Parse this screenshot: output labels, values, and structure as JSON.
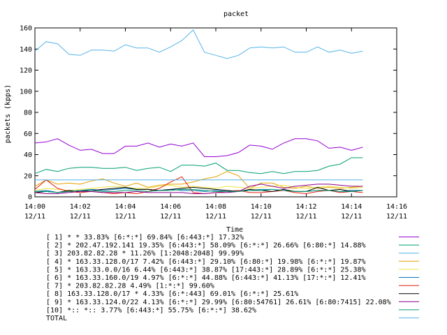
{
  "chart_data": {
    "type": "line",
    "title": "packet",
    "xlabel": "Time",
    "ylabel": "packets (kpps)",
    "ylim": [
      0,
      160
    ],
    "y_ticks": [
      "0",
      "20",
      "40",
      "60",
      "80",
      "100",
      "120",
      "140",
      "160"
    ],
    "x_ticks": [
      {
        "time": "14:00",
        "date": "12/11"
      },
      {
        "time": "14:02",
        "date": "12/11"
      },
      {
        "time": "14:04",
        "date": "12/11"
      },
      {
        "time": "14:06",
        "date": "12/11"
      },
      {
        "time": "14:08",
        "date": "12/11"
      },
      {
        "time": "14:10",
        "date": "12/11"
      },
      {
        "time": "14:12",
        "date": "12/11"
      },
      {
        "time": "14:14",
        "date": "12/11"
      },
      {
        "time": "14:16",
        "date": "12/11"
      }
    ],
    "xlim_minutes": [
      0,
      16
    ],
    "x": [
      0,
      0.5,
      1,
      1.5,
      2,
      2.5,
      3,
      3.5,
      4,
      4.5,
      5,
      5.5,
      6,
      6.5,
      7,
      7.5,
      8,
      8.5,
      9,
      9.5,
      10,
      10.5,
      11,
      11.5,
      12,
      12.5,
      13,
      13.5,
      14,
      14.5
    ],
    "series": [
      {
        "legend": "[ 1] * * 33.83%  [6:*:*] 69.84% [6:443:*] 17.32%",
        "color": "#9400d3",
        "values": [
          51,
          52,
          55,
          49,
          44,
          45,
          41,
          41,
          48,
          48,
          51,
          47,
          50,
          48,
          51,
          38,
          38,
          39,
          42,
          49,
          48,
          45,
          51,
          55,
          55,
          53,
          46,
          47,
          44,
          47
        ]
      },
      {
        "legend": "[ 2] * 202.47.192.141 19.35%  [6:443:*] 58.09% [6:*:*] 26.66% [6:80:*] 14.88%",
        "color": "#009e73",
        "values": [
          22,
          26,
          24,
          27,
          28,
          28,
          27,
          27,
          28,
          25,
          27,
          28,
          24,
          30,
          30,
          29,
          32,
          25,
          25,
          23,
          22,
          24,
          22,
          24,
          24,
          25,
          29,
          31,
          37,
          37
        ]
      },
      {
        "legend": "[ 3] 203.82.82.28 * 11.26%  [1:2048:2048] 99.99%",
        "color": "#56b4e9",
        "values": [
          138,
          147,
          145,
          135,
          134,
          139,
          139,
          138,
          144,
          141,
          141,
          137,
          142,
          148,
          158,
          137,
          134,
          131,
          134,
          141,
          142,
          141,
          142,
          137,
          137,
          142,
          137,
          139,
          136,
          138
        ]
      },
      {
        "legend": "[ 4] * 163.33.128.0/17 7.42%  [6:443:*] 29.10% [6:80:*] 19.98% [6:*:*] 19.87%",
        "color": "#e69f00",
        "values": [
          10,
          16,
          12,
          13,
          12,
          15,
          17,
          13,
          10,
          13,
          9,
          11,
          12,
          12,
          14,
          17,
          19,
          24,
          20,
          8,
          13,
          13,
          9,
          8,
          10,
          8,
          9,
          8,
          9,
          10
        ]
      },
      {
        "legend": "[ 5] * 163.33.0.0/16 6.44%  [6:443:*] 38.87% [17:443:*] 28.89% [6:*:*] 25.38%",
        "color": "#f0e442",
        "values": [
          6,
          8,
          7,
          6,
          7,
          8,
          9,
          10,
          9,
          8,
          8,
          10,
          11,
          9,
          10,
          9,
          8,
          10,
          9,
          8,
          9,
          10,
          11,
          9,
          8,
          9,
          10,
          9,
          8,
          9
        ]
      },
      {
        "legend": "[ 6] * 163.33.160.0/19 4.97%  [6:*:*] 44.88% [6:443:*] 41.13% [17:*:*] 12.41%",
        "color": "#0072b2",
        "values": [
          5,
          6,
          4,
          5,
          6,
          7,
          6,
          7,
          8,
          7,
          7,
          6,
          7,
          6,
          6,
          5,
          6,
          5,
          5,
          6,
          7,
          7,
          6,
          5,
          5,
          6,
          6,
          5,
          6,
          6
        ]
      },
      {
        "legend": "[ 7] * 203.82.82.28 4.49%  [1:*:*] 99.60%",
        "color": "#e51e10",
        "values": [
          7,
          16,
          8,
          5,
          4,
          5,
          4,
          3,
          4,
          3,
          5,
          8,
          14,
          19,
          4,
          3,
          4,
          5,
          6,
          4,
          4,
          5,
          6,
          4,
          3,
          5,
          6,
          4,
          5,
          4
        ]
      },
      {
        "legend": "[ 8] 163.33.128.0/17 * 4.33%  [6:*:443] 69.01% [6:*:*] 25.61%",
        "color": "#000000",
        "values": [
          4,
          5,
          4,
          6,
          5,
          6,
          7,
          8,
          9,
          7,
          7,
          6,
          7,
          8,
          9,
          8,
          7,
          6,
          5,
          7,
          6,
          5,
          7,
          5,
          5,
          9,
          6,
          7,
          5,
          6
        ]
      },
      {
        "legend": "[ 9] * 163.33.124.0/22 4.13%  [6:*:*] 29.99% [6:80:54761] 26.61% [6:80:7415] 22.08%",
        "color": "#8b008b",
        "values": [
          4,
          3,
          3,
          4,
          5,
          5,
          4,
          4,
          4,
          5,
          4,
          4,
          4,
          4,
          3,
          3,
          4,
          4,
          5,
          10,
          12,
          10,
          8,
          10,
          11,
          12,
          12,
          11,
          10,
          10
        ]
      },
      {
        "legend": "[10] *:: *:: 3.77%  [6:443:*] 55.75% [6:*:*] 38.62%",
        "color": "#009e73",
        "values": [
          5,
          5,
          4,
          5,
          6,
          6,
          5,
          5,
          6,
          6,
          5,
          6,
          6,
          7,
          7,
          6,
          5,
          5,
          5,
          6,
          6,
          7,
          6,
          5,
          5,
          6,
          6,
          5,
          5,
          6
        ]
      },
      {
        "legend": "TOTAL",
        "color": "#56b4e9",
        "values": [
          16,
          16,
          16,
          16,
          16,
          16,
          16,
          16,
          16,
          16,
          16,
          16,
          16,
          16,
          16,
          16,
          16,
          16,
          16,
          16,
          16,
          16,
          16,
          16,
          16,
          16,
          16,
          16,
          16,
          16
        ]
      }
    ]
  }
}
